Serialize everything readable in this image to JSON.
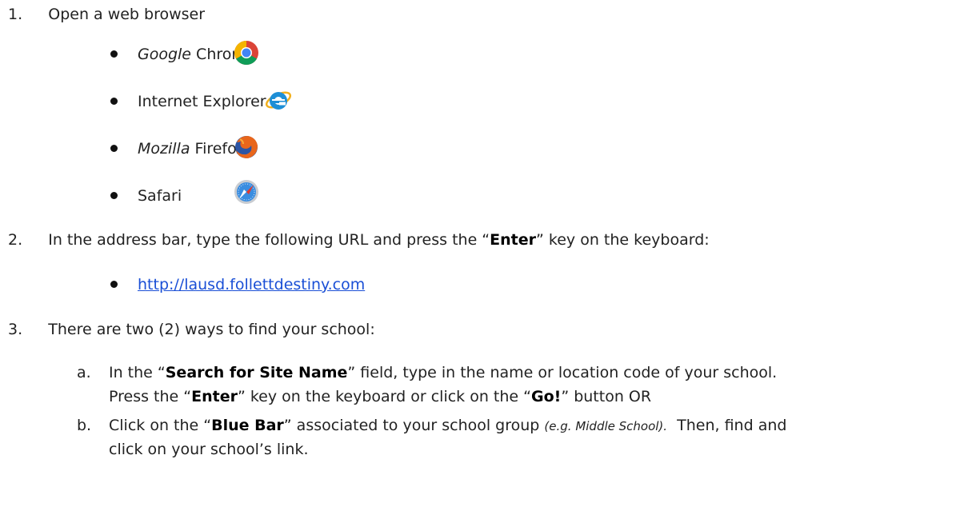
{
  "steps": {
    "s1": {
      "num": "1.",
      "text": "Open a web browser"
    },
    "browsers": [
      {
        "italic": "Google",
        "name": " Chrome",
        "icon": "chrome-icon"
      },
      {
        "italic": "",
        "name": "Internet Explorer",
        "icon": "internet-explorer-icon"
      },
      {
        "italic": "Mozilla",
        "name": " Firefox",
        "icon": "firefox-icon"
      },
      {
        "italic": "",
        "name": "Safari",
        "icon": "safari-icon"
      }
    ],
    "s2": {
      "num": "2.",
      "pre": "In the address bar, type the following URL and press the “",
      "key": "Enter",
      "post": "” key on the keyboard:",
      "url": "http://lausd.follettdestiny.com"
    },
    "s3": {
      "num": "3.",
      "text": "There are two (2) ways to find your school:",
      "a": {
        "letter": "a.",
        "l1_pre": "In the “",
        "l1_bold": "Search for Site Name",
        "l1_post": "” field, type in the name or location code of your school.",
        "l2_pre": "Press the “",
        "l2_key": "Enter",
        "l2_mid": "” key on the keyboard or click on the “",
        "l2_go": "Go!",
        "l2_post": "” button OR"
      },
      "b": {
        "letter": "b.",
        "l1_pre": "Click on the “",
        "l1_bold": "Blue Bar",
        "l1_mid": "” associated to your school group ",
        "l1_example": "(e.g. Middle School).",
        "l1_post": "  Then, find and",
        "l2": "click on your school’s link."
      }
    }
  },
  "colors": {
    "link": "#1a4fd6",
    "text": "#222222"
  }
}
